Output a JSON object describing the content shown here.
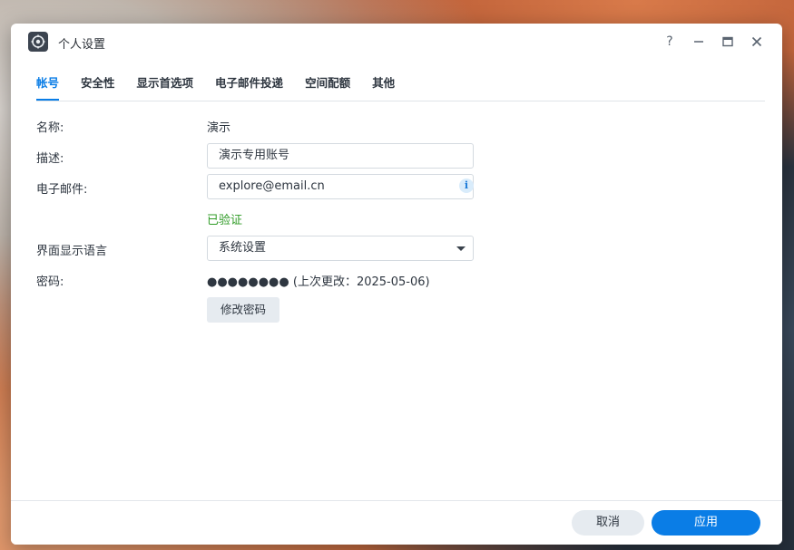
{
  "window": {
    "title": "个人设置",
    "controls": {
      "help": "?",
      "minimize": "—",
      "maximize": "▢",
      "close": "✕"
    }
  },
  "tabs": [
    {
      "label": "帐号",
      "active": true
    },
    {
      "label": "安全性",
      "active": false
    },
    {
      "label": "显示首选项",
      "active": false
    },
    {
      "label": "电子邮件投递",
      "active": false
    },
    {
      "label": "空间配额",
      "active": false
    },
    {
      "label": "其他",
      "active": false
    }
  ],
  "form": {
    "name": {
      "label": "名称:",
      "value": "演示"
    },
    "description": {
      "label": "描述:",
      "value": "演示专用账号"
    },
    "email": {
      "label": "电子邮件:",
      "value": "explore@email.cn",
      "status": "已验证"
    },
    "language": {
      "label": "界面显示语言",
      "value": "系统设置"
    },
    "password": {
      "label": "密码:",
      "value": "●●●●●●●● (上次更改：2025-05-06)",
      "change_button": "修改密码"
    }
  },
  "footer": {
    "cancel_label": "取消",
    "apply_label": "应用"
  },
  "colors": {
    "accent": "#0a7de6",
    "success": "#2f9b26"
  },
  "icons": {
    "app": "control-panel-icon",
    "info": "info-icon"
  }
}
